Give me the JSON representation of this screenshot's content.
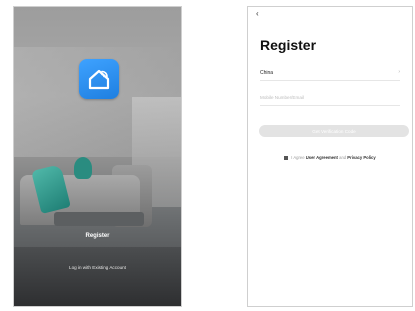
{
  "left_screen": {
    "register_label": "Register",
    "login_label": "Log in with Existing Account"
  },
  "right_screen": {
    "back_glyph": "‹",
    "title": "Register",
    "country_value": "China",
    "country_chevron": "›",
    "account_placeholder": "Mobile Number/Email",
    "verify_button_label": "Get Verification Code",
    "agreement": {
      "prefix": "I Agree",
      "user_agreement": "User Agreement",
      "and": "and",
      "privacy_policy": "Privacy Policy"
    }
  },
  "colors": {
    "logo_blue": "#2a8ff0",
    "button_disabled": "#e3e3e3"
  },
  "icons": {
    "logo": "smart-home-wifi-icon",
    "back": "back-arrow-icon",
    "chevron": "chevron-right-icon"
  }
}
